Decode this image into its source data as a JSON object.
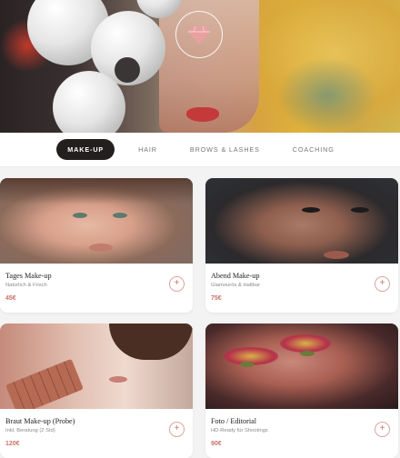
{
  "brand": {
    "logo": "diamond-logo"
  },
  "tabs": [
    {
      "label": "MAKE-UP",
      "active": true
    },
    {
      "label": "HAIR",
      "active": false
    },
    {
      "label": "BROWS & LASHES",
      "active": false
    },
    {
      "label": "COACHING",
      "active": false
    }
  ],
  "services": [
    {
      "title": "Tages Make-up",
      "subtitle": "Natürlich & Frisch",
      "price": "45€"
    },
    {
      "title": "Abend Make-up",
      "subtitle": "Glamourös & Haltbar",
      "price": "75€"
    },
    {
      "title": "Braut Make-up (Probe)",
      "subtitle": "Inkl. Beratung (2 Std)",
      "price": "120€"
    },
    {
      "title": "Foto / Editorial",
      "subtitle": "HD-Ready für Shootings",
      "price": "90€"
    }
  ],
  "add_symbol": "+",
  "colors": {
    "accent": "#c9746b",
    "tab_active_bg": "#231f1f",
    "logo": "#e8a0a0"
  }
}
